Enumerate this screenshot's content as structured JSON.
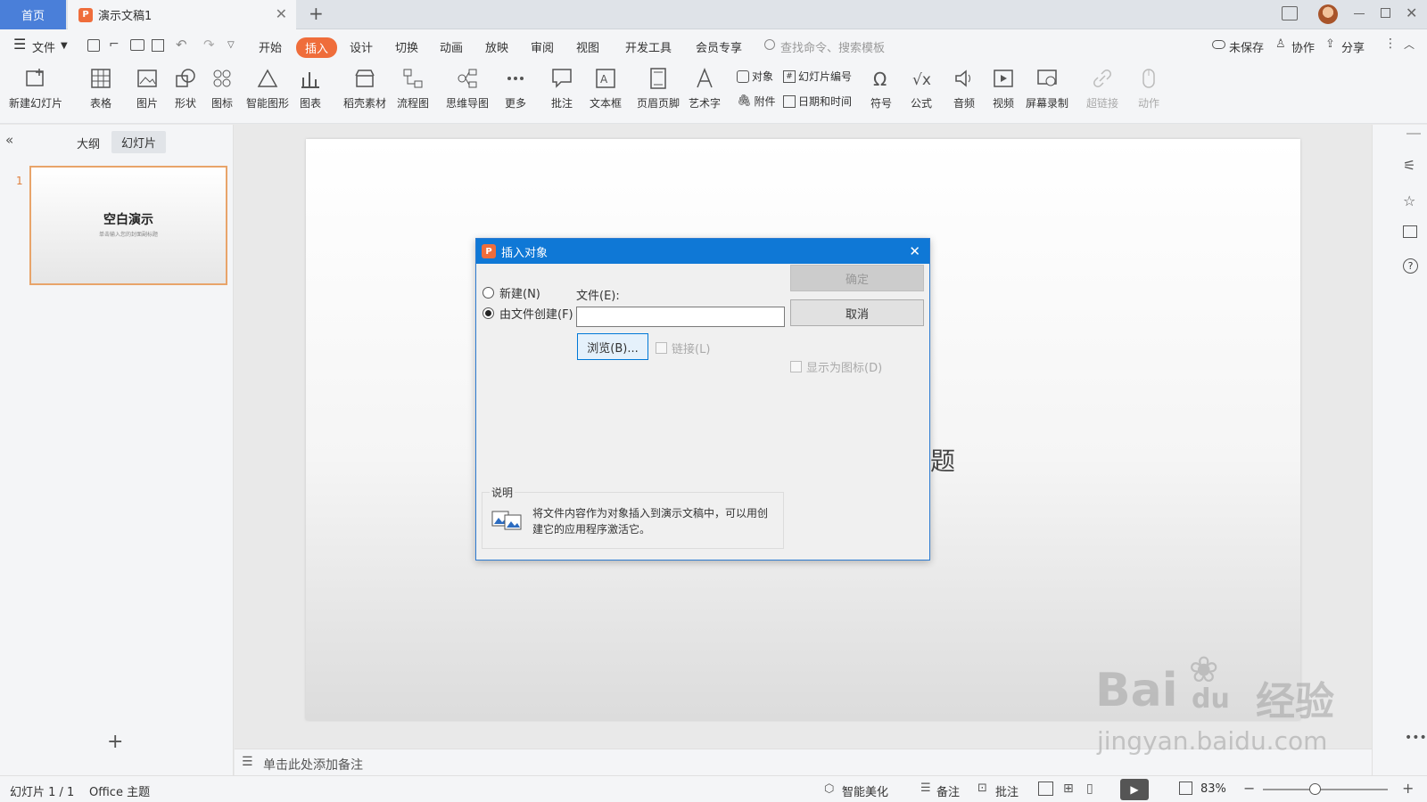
{
  "tabs": {
    "home": "首页",
    "doc": "演示文稿1",
    "new_tab": "+"
  },
  "menu": {
    "file": "文件",
    "items": [
      "开始",
      "插入",
      "设计",
      "切换",
      "动画",
      "放映",
      "审阅",
      "视图",
      "开发工具",
      "会员专享"
    ],
    "search_placeholder": "查找命令、搜索模板",
    "unsaved": "未保存",
    "collab": "协作",
    "share": "分享"
  },
  "ribbon": {
    "new_slide": "新建幻灯片",
    "table": "表格",
    "picture": "图片",
    "shape": "形状",
    "icon": "图标",
    "smart": "智能图形",
    "chart": "图表",
    "material": "稻壳素材",
    "flow": "流程图",
    "mind": "思维导图",
    "more": "更多",
    "comment": "批注",
    "textbox": "文本框",
    "header": "页眉页脚",
    "art": "艺术字",
    "object": "对象",
    "slide_no": "幻灯片编号",
    "attach": "附件",
    "datetime": "日期和时间",
    "symbol": "符号",
    "formula": "公式",
    "audio": "音频",
    "video": "视频",
    "record": "屏幕录制",
    "link": "超链接",
    "action": "动作"
  },
  "left": {
    "outline": "大纲",
    "slides": "幻灯片",
    "slide_num": "1",
    "thumb_title": "空白演示",
    "thumb_sub": "单击输入您的封面副标题"
  },
  "slide": {
    "title_fragment": "题"
  },
  "notes": {
    "placeholder": "单击此处添加备注"
  },
  "status": {
    "slide_info": "幻灯片 1 / 1",
    "theme": "Office 主题",
    "beautify": "智能美化",
    "notes": "备注",
    "comment": "批注",
    "zoom": "83%"
  },
  "dialog": {
    "title": "插入对象",
    "radio_new": "新建(N)",
    "radio_file": "由文件创建(F)",
    "file_label": "文件(E):",
    "file_value": "",
    "browse": "浏览(B)...",
    "link": "链接(L)",
    "ok": "确定",
    "cancel": "取消",
    "show_icon": "显示为图标(D)",
    "desc_label": "说明",
    "desc_text1": "将文件内容作为对象插入到演示文稿中，可以用创",
    "desc_text2": "建它的应用程序激活它。"
  },
  "watermark": {
    "brand": "Bai",
    "paw": "du",
    "cn": "经验",
    "url": "jingyan.baidu.com"
  },
  "colors": {
    "accent": "#ef6d3b",
    "dialog_blue": "#0f78d6",
    "home_tab": "#4a7fd9"
  }
}
